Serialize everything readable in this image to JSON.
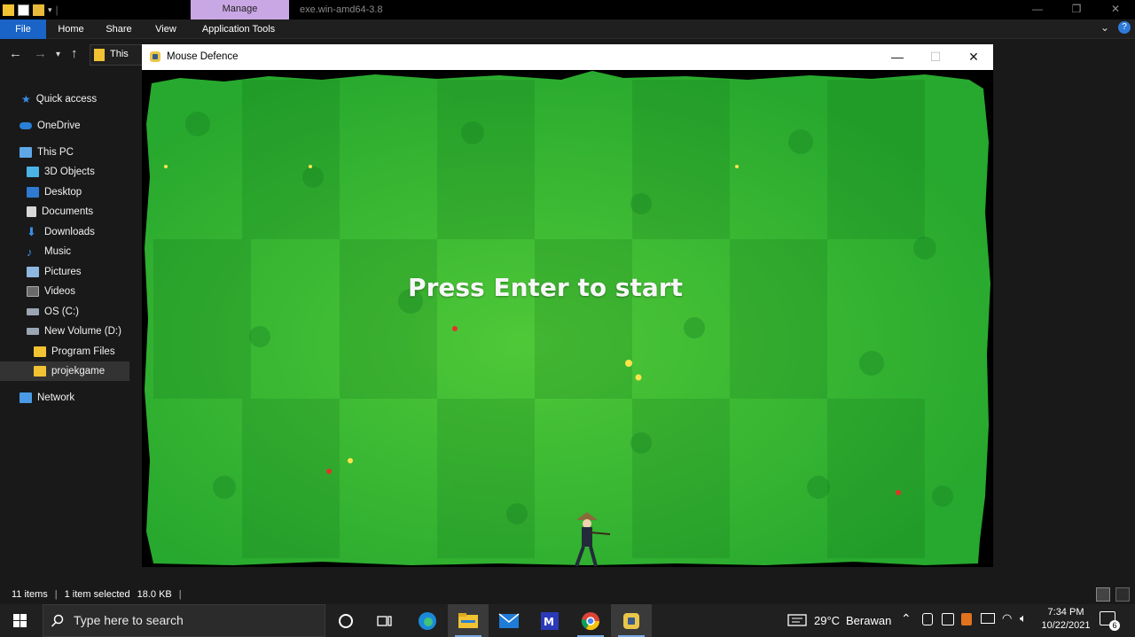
{
  "explorer": {
    "manage_tab": "Manage",
    "window_title": "exe.win-amd64-3.8",
    "ribbon_tabs": [
      "File",
      "Home",
      "Share",
      "View",
      "Application Tools"
    ],
    "address_partial": "This",
    "sidebar": {
      "quick_access": "Quick access",
      "onedrive": "OneDrive",
      "this_pc": "This PC",
      "items": [
        "3D Objects",
        "Desktop",
        "Documents",
        "Downloads",
        "Music",
        "Pictures",
        "Videos",
        "OS (C:)",
        "New Volume (D:)"
      ],
      "program_files": "Program Files",
      "projekgame": "projekgame",
      "network": "Network"
    },
    "status": {
      "item_count": "11 items",
      "selection": "1 item selected",
      "size": "18.0 KB"
    }
  },
  "game": {
    "window_title": "Mouse Defence",
    "prompt": "Press Enter to start"
  },
  "taskbar": {
    "search_placeholder": "Type here to search",
    "weather_temp": "29°C",
    "weather_desc": "Berawan",
    "time": "7:34 PM",
    "date": "10/22/2021",
    "notification_count": "6"
  },
  "colors": {
    "accent": "#1a63c7",
    "manage_tab": "#c9a6e4",
    "grass_light": "#35c23a",
    "grass_dark": "#1e8f24"
  }
}
